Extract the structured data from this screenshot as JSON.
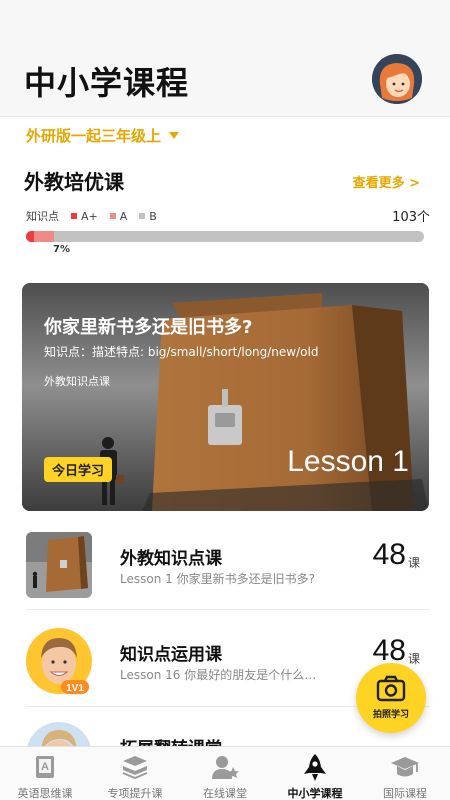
{
  "header": {
    "title": "中小学课程"
  },
  "grade": {
    "label": "外研版一起三年级上"
  },
  "section": {
    "title": "外教培优课",
    "more_label": "查看更多 >",
    "legend_title": "知识点",
    "legend": [
      {
        "label": "A+",
        "color": "#ee3b3b"
      },
      {
        "label": "A",
        "color": "#f08a86"
      },
      {
        "label": "B",
        "color": "#c2c2c2"
      }
    ],
    "count": "103个",
    "progress_percent_label": "7%",
    "progress": {
      "a_plus_fraction": 0.02,
      "a_fraction": 0.05
    }
  },
  "banner": {
    "title": "你家里新书多还是旧书多?",
    "knowledge": "知识点：描述特点: big/small/short/long/new/old",
    "tag": "外教知识点课",
    "today": "今日学习",
    "lesson": "Lesson 1"
  },
  "list": [
    {
      "title": "外教知识点课",
      "subtitle": "Lesson 1 你家里新书多还是旧书多?",
      "count": "48",
      "unit": "课"
    },
    {
      "title": "知识点运用课",
      "subtitle": "Lesson 16 你最好的朋友是个什么…",
      "count": "48",
      "unit": "课",
      "badge": "1V1"
    },
    {
      "title": "拓展翻转课堂",
      "subtitle": "",
      "count": "",
      "unit": ""
    }
  ],
  "photo_button": {
    "label": "拍照学习"
  },
  "tabs": [
    {
      "label": "英语思维课",
      "icon": "book-a-icon",
      "active": false
    },
    {
      "label": "专项提升课",
      "icon": "books-stack-icon",
      "active": false
    },
    {
      "label": "在线课堂",
      "icon": "person-star-icon",
      "active": false
    },
    {
      "label": "中小学课程",
      "icon": "rocket-icon",
      "active": true
    },
    {
      "label": "国际课程",
      "icon": "graduation-cap-icon",
      "active": false
    }
  ]
}
